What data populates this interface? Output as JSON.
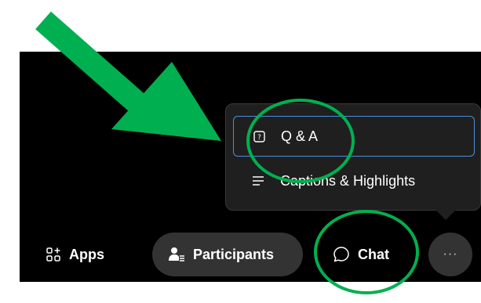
{
  "menu": {
    "items": [
      {
        "label": "Q & A",
        "icon": "qa-icon"
      },
      {
        "label": "Captions & Highlights",
        "icon": "captions-icon"
      }
    ]
  },
  "toolbar": {
    "apps_label": "Apps",
    "participants_label": "Participants",
    "chat_label": "Chat",
    "more_label": "···"
  },
  "colors": {
    "background": "#000000",
    "popup_bg": "#1f1f1f",
    "focus_border": "#4a90d9",
    "pill_bg": "#333333",
    "annotation_green": "#00b050"
  }
}
